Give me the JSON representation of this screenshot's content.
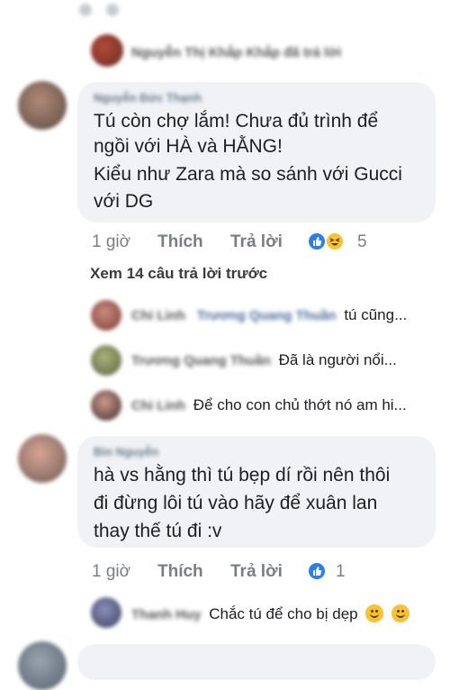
{
  "top_reply": {
    "name": "Nguyễn Thị Khắp Khắp đã trả lời"
  },
  "comment1": {
    "author": "Nguyễn Đức Thạnh",
    "lines": [
      "Tú còn chợ lắm! Chưa đủ trình để",
      "ngồi với HÀ và HẰNG!",
      "Kiểu như Zara mà so sánh với Gucci",
      "với DG"
    ],
    "time": "1 giờ",
    "like_label": "Thích",
    "reply_label": "Trả lời",
    "reaction_count": "5"
  },
  "view_previous": "Xem 14 câu trả lời trước",
  "replies": [
    {
      "name": "Chi Linh",
      "mention": "Trương Quang Thuần",
      "text": "tú cũng..."
    },
    {
      "name": "Trương Quang Thuần",
      "mention": "",
      "text": "Đã là người nổi..."
    },
    {
      "name": "Chi Linh",
      "mention": "",
      "text": "Để cho con chủ thớt nó am hi..."
    }
  ],
  "comment2": {
    "author": "Bin Nguyễn",
    "lines": [
      "hà vs hằng thì tú bẹp dí rồi nên thôi",
      "đi đừng lôi tú vào hãy để xuân lan",
      "thay thế tú đi :v"
    ],
    "time": "1 giờ",
    "like_label": "Thích",
    "reply_label": "Trả lời",
    "reaction_count": "1"
  },
  "bottom_reply": {
    "name": "Thanh Huy",
    "text": "Chắc tú để cho bị dẹp"
  },
  "colors": {
    "bubble": "#f0f2f5",
    "like_blue": "#2d7fe8",
    "haha_yellow": "#f7c233",
    "meta_gray": "#7a7d82"
  }
}
